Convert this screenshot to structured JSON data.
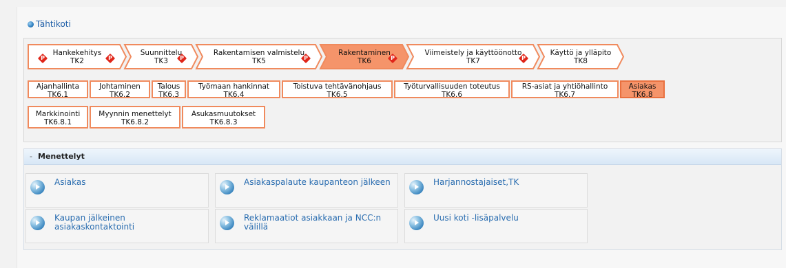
{
  "breadcrumb": {
    "home_label": "Tähtikoti"
  },
  "phases": [
    {
      "line1": "Hankekehitys",
      "line2": "TK2",
      "has_p": true,
      "active": false
    },
    {
      "line1": "Suunnittelu",
      "line2": "TK3",
      "has_p": true,
      "active": false
    },
    {
      "line1": "Rakentamisen valmistelu",
      "line2": "TK5",
      "has_p": true,
      "active": false
    },
    {
      "line1": "Rakentaminen",
      "line2": "TK6",
      "has_p": true,
      "active": true
    },
    {
      "line1": "Viimeistely ja käyttöönotto",
      "line2": "TK7",
      "has_p": true,
      "active": false
    },
    {
      "line1": "Käyttö ja ylläpito",
      "line2": "TK8",
      "has_p": false,
      "active": false
    }
  ],
  "p_badge_label": "P",
  "subphases": [
    {
      "line1": "Ajanhallinta",
      "line2": "TK6.1",
      "active": false
    },
    {
      "line1": "Johtaminen",
      "line2": "TK6.2",
      "active": false
    },
    {
      "line1": "Talous",
      "line2": "TK6.3",
      "active": false
    },
    {
      "line1": "Työmaan hankinnat",
      "line2": "TK6.4",
      "active": false
    },
    {
      "line1": "Toistuva tehtävänohjaus",
      "line2": "TK6.5",
      "active": false
    },
    {
      "line1": "Työturvallisuuden toteutus",
      "line2": "TK6.6",
      "active": false
    },
    {
      "line1": "RS-asiat ja yhtiöhallinto",
      "line2": "TK6.7",
      "active": false
    },
    {
      "line1": "Asiakas",
      "line2": "TK6.8",
      "active": true
    }
  ],
  "subsubphases": [
    {
      "line1": "Markkinointi",
      "line2": "TK6.8.1"
    },
    {
      "line1": "Myynnin menettelyt",
      "line2": "TK6.8.2"
    },
    {
      "line1": "Asukasmuutokset",
      "line2": "TK6.8.3"
    }
  ],
  "methods": {
    "toggle": "-",
    "title": "Menettelyt",
    "items": [
      {
        "label": "Asiakas"
      },
      {
        "label": "Asiakaspalaute kaupanteon jälkeen"
      },
      {
        "label": "Harjannostajaiset,TK"
      },
      {
        "label": "Kaupan jälkeinen asiakaskontaktointi"
      },
      {
        "label": "Reklamaatiot asiakkaan ja NCC:n välillä"
      },
      {
        "label": "Uusi koti -lisäpalvelu"
      }
    ]
  },
  "colors": {
    "accent_orange": "#f08a5d",
    "active_fill": "#f5946a",
    "link_blue": "#2a6db0",
    "badge_red": "#e0261a"
  }
}
